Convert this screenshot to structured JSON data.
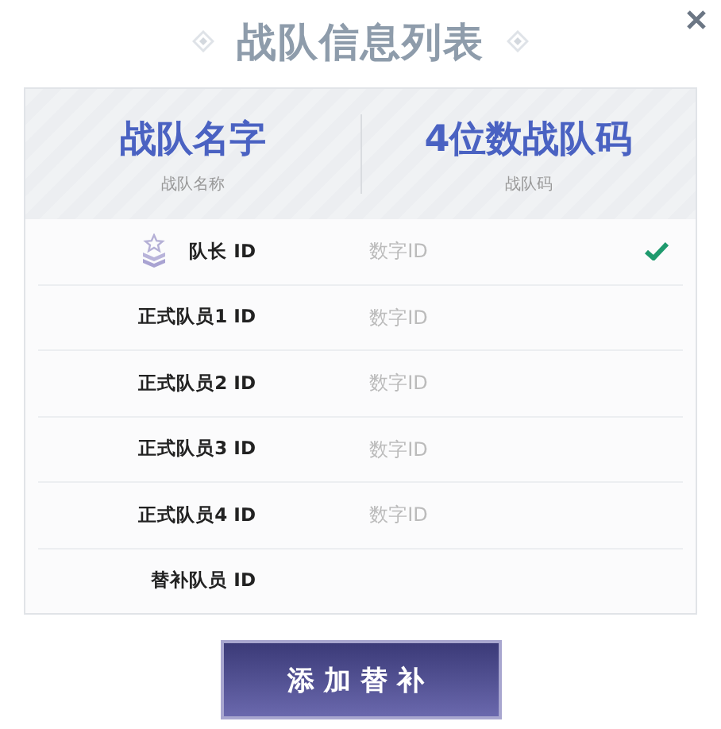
{
  "title": "战队信息列表",
  "header": [
    {
      "title": "战队名字",
      "subtitle": "战队名称"
    },
    {
      "title": "4位数战队码",
      "subtitle": "战队码"
    }
  ],
  "rows": [
    {
      "kind": "captain",
      "label": "队长 ID",
      "placeholder": "数字ID",
      "verified": true
    },
    {
      "kind": "member",
      "label": "正式队员1 ID",
      "placeholder": "数字ID",
      "verified": false
    },
    {
      "kind": "member",
      "label": "正式队员2 ID",
      "placeholder": "数字ID",
      "verified": false
    },
    {
      "kind": "member",
      "label": "正式队员3 ID",
      "placeholder": "数字ID",
      "verified": false
    },
    {
      "kind": "member",
      "label": "正式队员4 ID",
      "placeholder": "数字ID",
      "verified": false
    },
    {
      "kind": "member",
      "label": "替补队员 ID",
      "verified": false
    }
  ],
  "button": "添加替补"
}
